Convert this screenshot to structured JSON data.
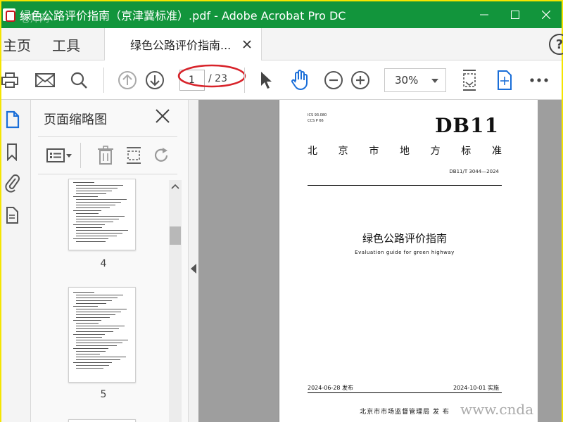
{
  "window": {
    "title": "绿色公路评价指南（京津冀标准）.pdf - Adobe Acrobat Pro DC",
    "title_bar_color": "#12953c"
  },
  "tabs": {
    "home": "主页",
    "tools": "工具",
    "document": "绿色公路评价指南..."
  },
  "toolbar": {
    "current_page": "1",
    "total_pages": "/ 23",
    "zoom": "30%",
    "highlight_color": "#d8232a"
  },
  "thumbnails_panel": {
    "title": "页面缩略图",
    "pages": [
      {
        "number": "4"
      },
      {
        "number": "5"
      }
    ]
  },
  "document_page": {
    "ics_line1": "ICS 93.080",
    "ics_line2": "CCS P 66",
    "code": "DB11",
    "bureau_chars": [
      "北",
      "京",
      "市",
      "地",
      "方",
      "标",
      "准"
    ],
    "standard_number": "DB11/T 3044—2024",
    "title_cn": "绿色公路评价指南",
    "title_en": "Evaluation guide for green highway",
    "publish_date": "2024-06-28 发布",
    "implement_date": "2024-10-01 实施",
    "issuer": "北京市市场监督管理局  发 布"
  },
  "watermark": {
    "bottom_right": "www.cnda",
    "top_left": "老师网"
  }
}
